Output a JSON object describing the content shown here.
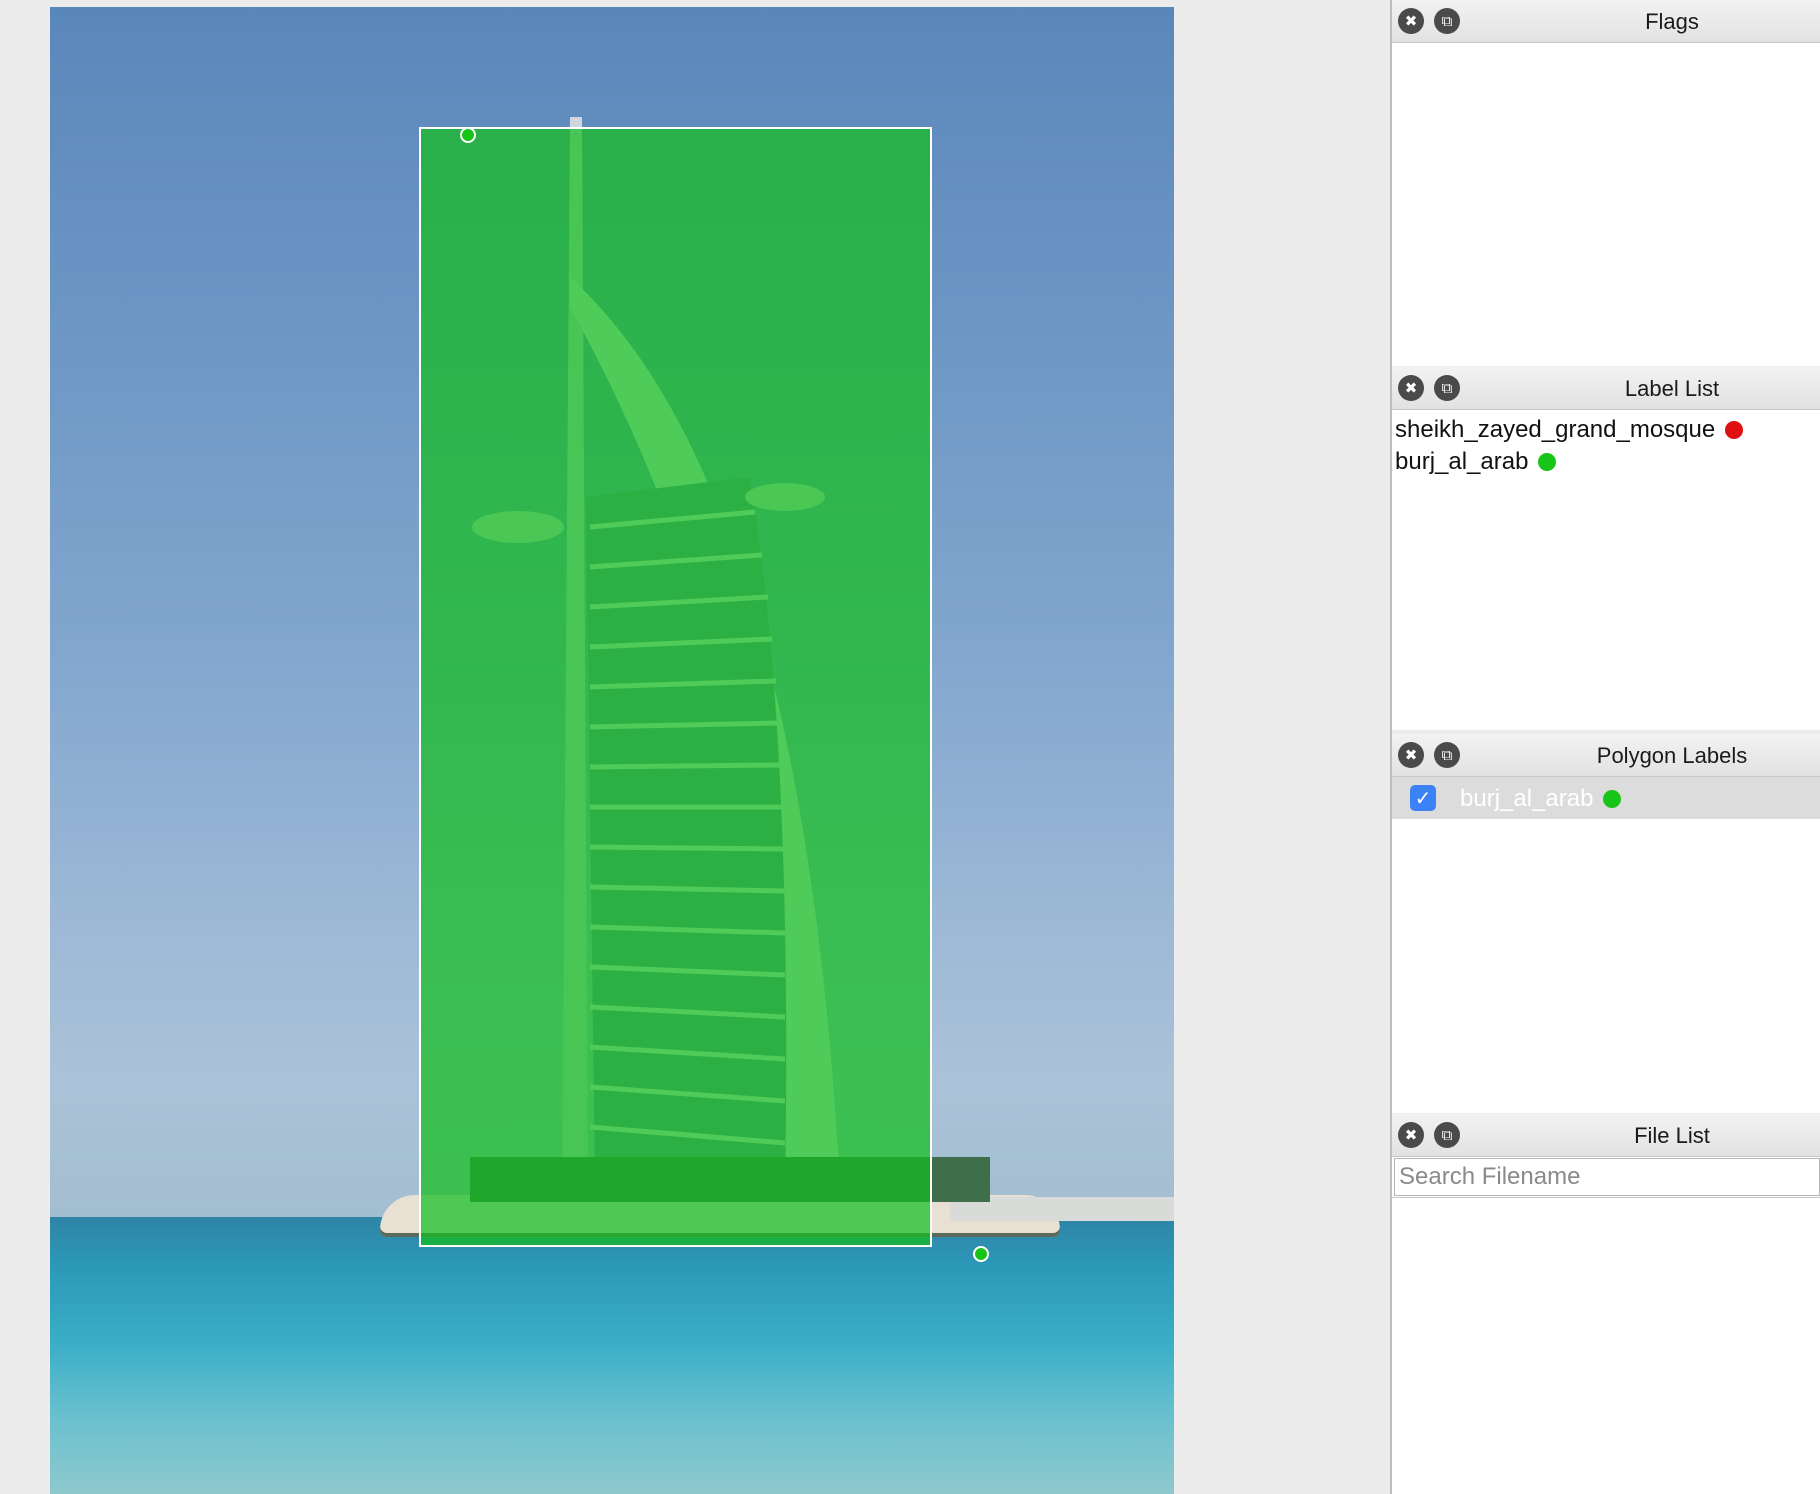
{
  "panels": {
    "flags": {
      "title": "Flags"
    },
    "label_list": {
      "title": "Label List",
      "items": [
        {
          "label": "sheikh_zayed_grand_mosque",
          "color": "#e01010"
        },
        {
          "label": "burj_al_arab",
          "color": "#19c419"
        }
      ]
    },
    "polygon_labels": {
      "title": "Polygon Labels",
      "items": [
        {
          "label": "burj_al_arab",
          "checked": true,
          "color": "#19c419"
        }
      ]
    },
    "file_list": {
      "title": "File List",
      "search_placeholder": "Search Filename"
    }
  },
  "canvas": {
    "annotation_label": "burj_al_arab",
    "annotation_color": "#19c419"
  }
}
